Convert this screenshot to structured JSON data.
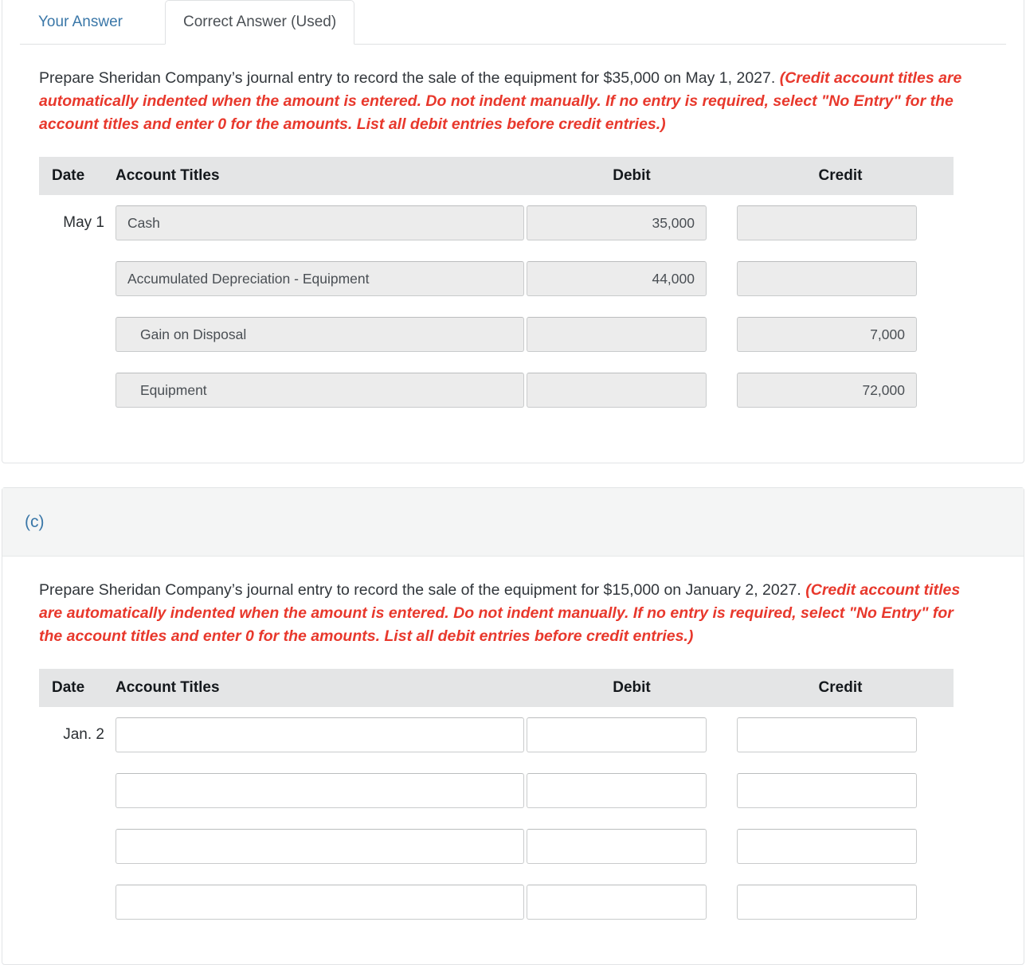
{
  "tabs": [
    {
      "label": "Your Answer",
      "active": false
    },
    {
      "label": "Correct Answer (Used)",
      "active": true
    }
  ],
  "sections": [
    {
      "id": "b",
      "label": "",
      "prompt_plain": "Prepare Sheridan Company’s journal entry to record the sale of the equipment for $35,000 on May 1, 2027. ",
      "prompt_hint": "(Credit account titles are automatically indented when the amount is entered. Do not indent manually. If no entry is required, select \"No Entry\" for the account titles and enter 0 for the amounts. List all debit entries before credit entries.)",
      "table": {
        "headers": {
          "date": "Date",
          "account_titles": "Account Titles",
          "debit": "Debit",
          "credit": "Credit"
        },
        "rows": [
          {
            "date": "May 1",
            "account": "Cash",
            "indent": false,
            "debit": "35,000",
            "credit": "",
            "readonly": true
          },
          {
            "date": "",
            "account": "Accumulated Depreciation - Equipment",
            "indent": false,
            "debit": "44,000",
            "credit": "",
            "readonly": true
          },
          {
            "date": "",
            "account": "Gain on Disposal",
            "indent": true,
            "debit": "",
            "credit": "7,000",
            "readonly": true
          },
          {
            "date": "",
            "account": "Equipment",
            "indent": true,
            "debit": "",
            "credit": "72,000",
            "readonly": true
          }
        ]
      }
    },
    {
      "id": "c",
      "label": "(c)",
      "prompt_plain": "Prepare Sheridan Company’s journal entry to record the sale of the equipment for $15,000 on January 2, 2027. ",
      "prompt_hint": "(Credit account titles are automatically indented when the amount is entered. Do not indent manually. If no entry is required, select \"No Entry\" for the account titles and enter 0 for the amounts. List all debit entries before credit entries.)",
      "table": {
        "headers": {
          "date": "Date",
          "account_titles": "Account Titles",
          "debit": "Debit",
          "credit": "Credit"
        },
        "rows": [
          {
            "date": "Jan. 2",
            "account": "",
            "indent": false,
            "debit": "",
            "credit": "",
            "readonly": false
          },
          {
            "date": "",
            "account": "",
            "indent": false,
            "debit": "",
            "credit": "",
            "readonly": false
          },
          {
            "date": "",
            "account": "",
            "indent": false,
            "debit": "",
            "credit": "",
            "readonly": false
          },
          {
            "date": "",
            "account": "",
            "indent": false,
            "debit": "",
            "credit": "",
            "readonly": false
          }
        ]
      }
    }
  ],
  "colors": {
    "link": "#3a77a8",
    "hint": "#e8382c",
    "header_bg": "#e4e5e6",
    "disabled_field": "#ececec",
    "section_band": "#f4f5f5"
  }
}
